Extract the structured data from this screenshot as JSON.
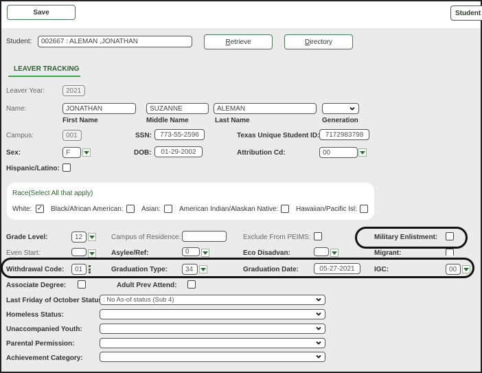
{
  "toolbar": {
    "save_label": "Save",
    "student_label": "Student"
  },
  "student_bar": {
    "label": "Student:",
    "value": "002667 : ALEMAN ,JONATHAN",
    "retrieve_label": "Retrieve",
    "directory_label": "Directory"
  },
  "tab": {
    "label": "LEAVER TRACKING"
  },
  "form": {
    "leaver_year_label": "Leaver Year:",
    "leaver_year": "2021",
    "name_label": "Name:",
    "first_name": "JONATHAN",
    "middle_name": "SUZANNE",
    "last_name": "ALEMAN",
    "generation": "",
    "first_name_caption": "First Name",
    "middle_name_caption": "Middle Name",
    "last_name_caption": "Last Name",
    "generation_caption": "Generation",
    "campus_label": "Campus:",
    "campus": "001",
    "ssn_label": "SSN:",
    "ssn": "773-55-2596",
    "tsid_label": "Texas Unique Student ID:",
    "tsid": "7172983798",
    "sex_label": "Sex:",
    "sex": "F",
    "dob_label": "DOB:",
    "dob": "01-29-2002",
    "attribution_label": "Attribution Cd:",
    "attribution": "00",
    "hispanic_label": "Hispanic/Latino:",
    "hispanic_checked": false
  },
  "race": {
    "title": "Race(Select All that apply)",
    "items": [
      {
        "label": "White:",
        "checked": true,
        "mark": "✓"
      },
      {
        "label": "Black/African American:",
        "checked": false,
        "mark": ""
      },
      {
        "label": "Asian:",
        "checked": false,
        "mark": ""
      },
      {
        "label": "American Indian/Alaskan Native:",
        "checked": false,
        "mark": ""
      },
      {
        "label": "Hawaiian/Pacific Isl:",
        "checked": false,
        "mark": ""
      }
    ]
  },
  "details": {
    "grade_level_label": "Grade Level:",
    "grade_level": "12",
    "campus_residence_label": "Campus of Residence:",
    "campus_residence": "",
    "exclude_peims_label": "Exclude From PEIMS:",
    "military_label": "Military Enlistment:",
    "even_start_label": "Even Start:",
    "even_start": "",
    "asylee_label": "Asylee/Ref:",
    "asylee": "0",
    "eco_label": "Eco Disadvan:",
    "eco": "",
    "migrant_label": "Migrant:",
    "withdrawal_label": "Withdrawal Code:",
    "withdrawal": "01",
    "grad_type_label": "Graduation Type:",
    "grad_type": "34",
    "grad_date_label": "Graduation Date:",
    "grad_date": "05-27-2021",
    "igc_label": "IGC:",
    "igc": "00",
    "assoc_label": "Associate Degree:",
    "adult_label": "Adult Prev Attend:"
  },
  "selects": [
    {
      "label": "Last Friday of October Status:",
      "value": ": No As-of status (Sub 4)"
    },
    {
      "label": "Homeless Status:",
      "value": ""
    },
    {
      "label": "Unaccompanied Youth:",
      "value": ""
    },
    {
      "label": "Parental Permission:",
      "value": ""
    },
    {
      "label": "Achievement Category:",
      "value": ""
    }
  ]
}
